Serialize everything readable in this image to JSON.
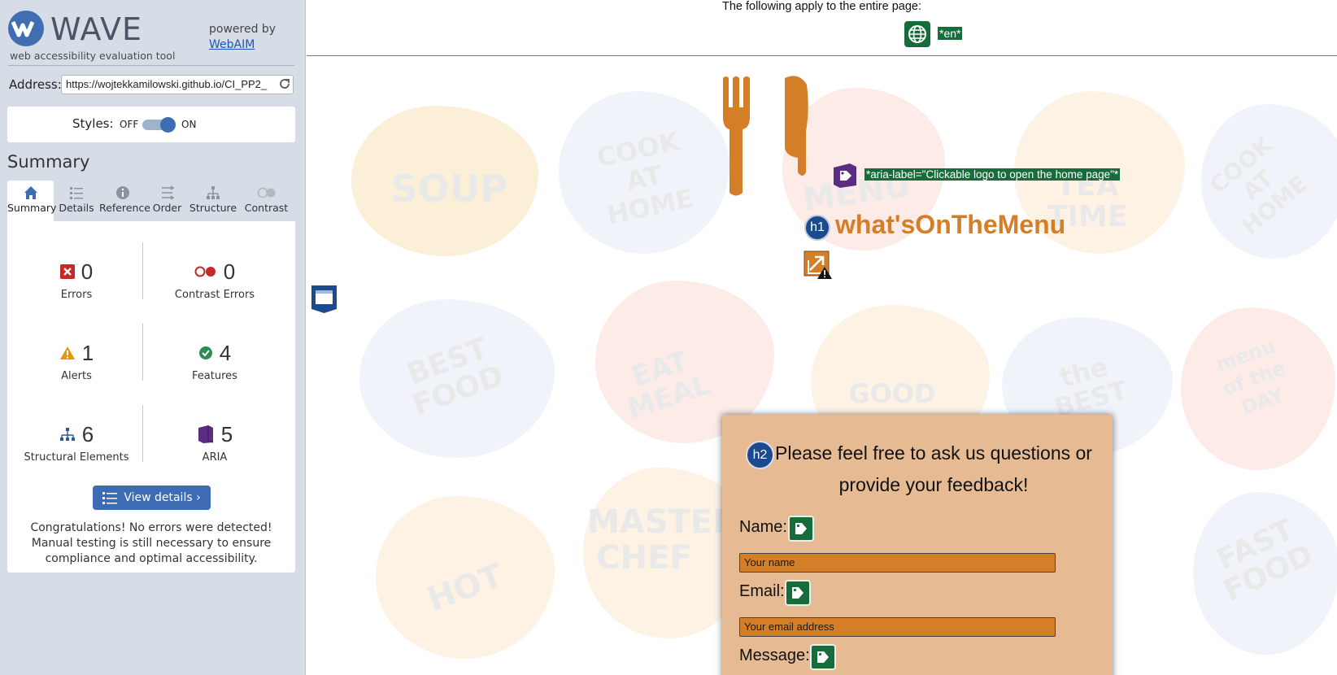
{
  "sidebar": {
    "logo_word": "WAVE",
    "tagline": "web accessibility evaluation tool",
    "powered_by": "powered by",
    "webaim_link": "WebAIM",
    "address_label": "Address:",
    "address_value": "https://wojtekkamilowski.github.io/CI_PP2_",
    "styles_label": "Styles:",
    "styles_off": "OFF",
    "styles_on": "ON",
    "styles_enabled": true,
    "summary_title": "Summary",
    "tabs": [
      {
        "label": "Summary",
        "icon": "home-icon",
        "active": true
      },
      {
        "label": "Details",
        "icon": "list-icon",
        "active": false
      },
      {
        "label": "Reference",
        "icon": "info-icon",
        "active": false
      },
      {
        "label": "Order",
        "icon": "order-icon",
        "active": false
      },
      {
        "label": "Structure",
        "icon": "structure-icon",
        "active": false
      },
      {
        "label": "Contrast",
        "icon": "contrast-icon",
        "active": false
      }
    ],
    "stats": {
      "errors": {
        "count": "0",
        "label": "Errors",
        "color": "#c62828"
      },
      "contrast_errors": {
        "count": "0",
        "label": "Contrast Errors",
        "color": "#c62828"
      },
      "alerts": {
        "count": "1",
        "label": "Alerts",
        "color": "#e6960f"
      },
      "features": {
        "count": "4",
        "label": "Features",
        "color": "#2e8b57"
      },
      "structural": {
        "count": "6",
        "label": "Structural Elements",
        "color": "#2a5aa0"
      },
      "aria": {
        "count": "5",
        "label": "ARIA",
        "color": "#5a2d82"
      }
    },
    "view_details": "View details ›",
    "congrats": "Congratulations! No errors were detected! Manual testing is still necessary to ensure compliance and optimal accessibility."
  },
  "page": {
    "apply_text": "The following apply to the entire page:",
    "lang_tag": "*en*",
    "aria_label_tag": "*aria-label=\"Clickable logo to open the home page\"*",
    "h1_badge": "h1",
    "site_title": "what'sOnTheMenu",
    "h2_badge": "h2",
    "card_heading": "Please feel free to ask us questions or provide your feedback!",
    "form": {
      "name_label": "Name:",
      "name_placeholder": "Your name",
      "email_label": "Email:",
      "email_placeholder": "Your email address",
      "message_label": "Message:"
    },
    "doodles": [
      "SOUP",
      "COOK AT HOME",
      "MENU",
      "TEA TIME",
      "COOK AT HOME",
      "BEST FOOD",
      "EAT MEAL",
      "GOOD",
      "the BEST",
      "menu of the DAY",
      "HOT",
      "MASTER CHEF",
      "FAST FOOD"
    ]
  },
  "colors": {
    "wave_blue": "#3d6cb3",
    "feature_green": "#176c3c",
    "brand_orange": "#d57e28",
    "card_bg": "#e6bb93",
    "aria_purple": "#5a2d82"
  }
}
